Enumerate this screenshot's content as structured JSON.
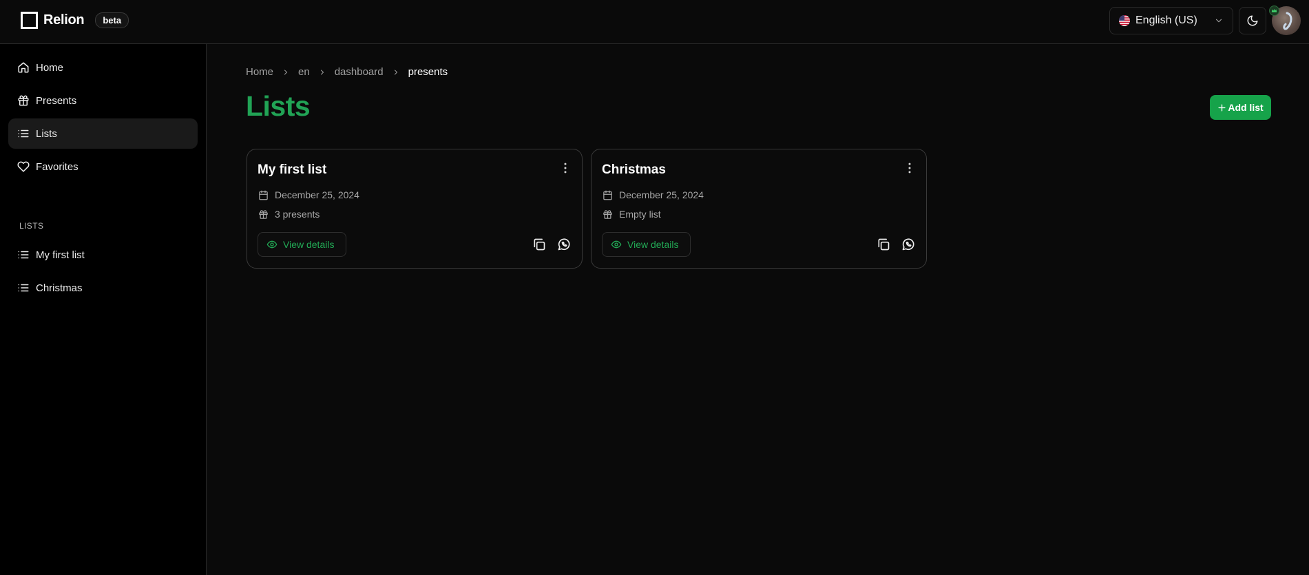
{
  "app": {
    "brand_name": "Relion",
    "badge": "beta"
  },
  "header": {
    "language": "English (US)",
    "theme_icon": "moon-icon",
    "avatar_icon": "avatar"
  },
  "sidebar": {
    "nav": [
      {
        "label": "Home",
        "icon": "home-icon"
      },
      {
        "label": "Presents",
        "icon": "gift-icon"
      },
      {
        "label": "Lists",
        "icon": "list-icon",
        "active": true
      },
      {
        "label": "Favorites",
        "icon": "heart-icon"
      }
    ],
    "section_label": "LISTS",
    "lists": [
      {
        "label": "My first list",
        "icon": "list-icon"
      },
      {
        "label": "Christmas",
        "icon": "list-icon"
      }
    ]
  },
  "breadcrumb": [
    "Home",
    "en",
    "dashboard",
    "presents"
  ],
  "page": {
    "title": "Lists",
    "add_button": "Add list"
  },
  "cards": [
    {
      "title": "My first list",
      "date": "December 25, 2024",
      "count": "3 presents",
      "view_label": "View details"
    },
    {
      "title": "Christmas",
      "date": "December 25, 2024",
      "count": "Empty list",
      "view_label": "View details"
    }
  ],
  "colors": {
    "accent": "#16a34a",
    "title_green": "#21a355",
    "background": "#0a0a0a",
    "sidebar_bg": "#000000"
  }
}
